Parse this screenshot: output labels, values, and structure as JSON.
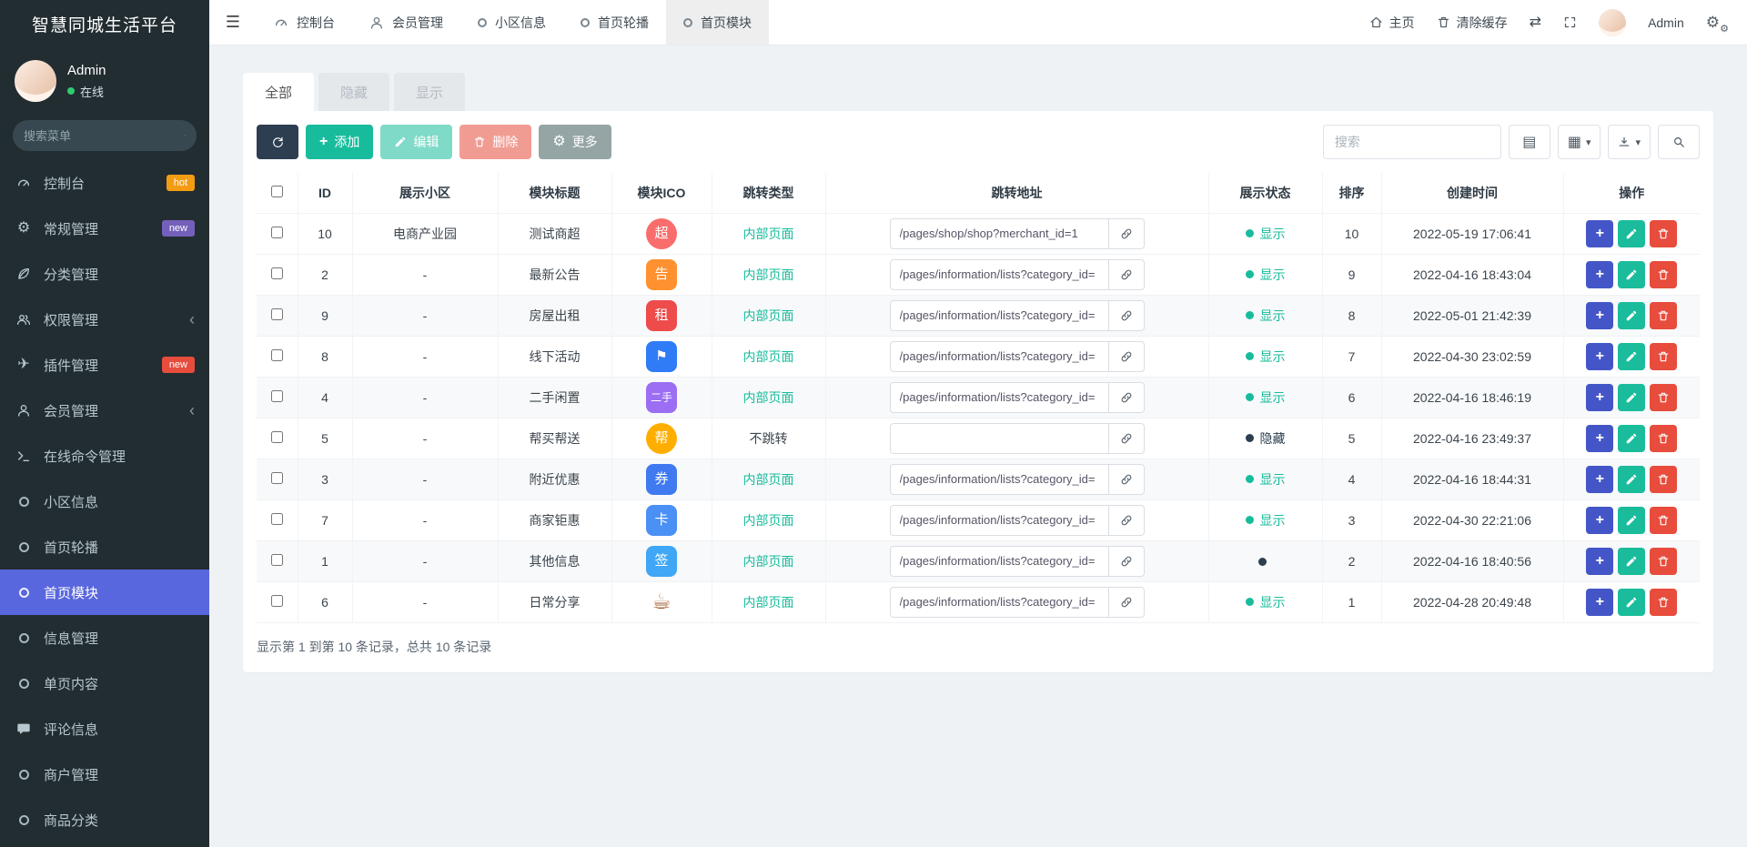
{
  "app": {
    "title": "智慧同城生活平台"
  },
  "colors": {
    "sidebar_bg": "#222d32",
    "accent_active": "#5867dd",
    "success": "#18bc9c",
    "danger": "#e74c3c",
    "warning": "#f39c12",
    "dark": "#2c3e50",
    "secondary": "#95a5a6"
  },
  "sidebar": {
    "user": {
      "name": "Admin",
      "status": "在线"
    },
    "search_placeholder": "搜索菜单",
    "items": [
      {
        "label": "控制台",
        "icon": "dashboard-icon",
        "badge": "hot",
        "badge_color": "#f39c12"
      },
      {
        "label": "常规管理",
        "icon": "gears-icon",
        "badge": "new",
        "badge_color": "#7460ba"
      },
      {
        "label": "分类管理",
        "icon": "leaf-icon"
      },
      {
        "label": "权限管理",
        "icon": "users-icon",
        "chevron": "‹"
      },
      {
        "label": "插件管理",
        "icon": "rocket-icon",
        "badge": "new",
        "badge_color": "#e74c3c"
      },
      {
        "label": "会员管理",
        "icon": "user-icon",
        "chevron": "‹"
      },
      {
        "label": "在线命令管理",
        "icon": "terminal-icon"
      },
      {
        "label": "小区信息",
        "icon": "circle-icon"
      },
      {
        "label": "首页轮播",
        "icon": "circle-icon"
      },
      {
        "label": "首页模块",
        "icon": "circle-icon",
        "active": true
      },
      {
        "label": "信息管理",
        "icon": "circle-icon"
      },
      {
        "label": "单页内容",
        "icon": "circle-icon"
      },
      {
        "label": "评论信息",
        "icon": "comment-icon"
      },
      {
        "label": "商户管理",
        "icon": "circle-icon"
      },
      {
        "label": "商品分类",
        "icon": "circle-icon"
      }
    ]
  },
  "topbar": {
    "tabs": [
      {
        "label": "控制台",
        "icon": "dashboard-icon"
      },
      {
        "label": "会员管理",
        "icon": "user-icon"
      },
      {
        "label": "小区信息",
        "icon": "circle-icon"
      },
      {
        "label": "首页轮播",
        "icon": "circle-icon"
      },
      {
        "label": "首页模块",
        "icon": "circle-icon",
        "active": true
      }
    ],
    "home": "主页",
    "clear_cache": "清除缓存",
    "username": "Admin"
  },
  "filter_tabs": [
    {
      "label": "全部",
      "active": true
    },
    {
      "label": "隐藏"
    },
    {
      "label": "显示"
    }
  ],
  "toolbar": {
    "add": "添加",
    "edit": "编辑",
    "delete": "删除",
    "more": "更多",
    "search_placeholder": "搜索"
  },
  "table": {
    "headers": [
      "ID",
      "展示小区",
      "模块标题",
      "模块ICO",
      "跳转类型",
      "跳转地址",
      "展示状态",
      "排序",
      "创建时间",
      "操作"
    ],
    "rows": [
      {
        "id": "10",
        "community": "电商产业园",
        "title": "测试商超",
        "ico": {
          "glyph": "超",
          "bg": "#f96d6d"
        },
        "jump_type": "内部页面",
        "url": "/pages/shop/shop?merchant_id=1",
        "status": "显示",
        "sort": "10",
        "created": "2022-05-19 17:06:41"
      },
      {
        "id": "2",
        "community": "-",
        "title": "最新公告",
        "ico": {
          "glyph": "告",
          "bg": "#ff9130"
        },
        "jump_type": "内部页面",
        "url": "/pages/information/lists?category_id=",
        "status": "显示",
        "sort": "9",
        "created": "2022-04-16 18:43:04"
      },
      {
        "id": "9",
        "community": "-",
        "title": "房屋出租",
        "ico": {
          "glyph": "租",
          "bg": "#ee4b4b"
        },
        "jump_type": "内部页面",
        "url": "/pages/information/lists?category_id=",
        "status": "显示",
        "sort": "8",
        "created": "2022-05-01 21:42:39"
      },
      {
        "id": "8",
        "community": "-",
        "title": "线下活动",
        "ico": {
          "glyph": "⚑",
          "bg": "#2f7cf6"
        },
        "jump_type": "内部页面",
        "url": "/pages/information/lists?category_id=",
        "status": "显示",
        "sort": "7",
        "created": "2022-04-30 23:02:59"
      },
      {
        "id": "4",
        "community": "-",
        "title": "二手闲置",
        "ico": {
          "glyph": "二手",
          "bg": "#9b6ef3"
        },
        "jump_type": "内部页面",
        "url": "/pages/information/lists?category_id=",
        "status": "显示",
        "sort": "6",
        "created": "2022-04-16 18:46:19"
      },
      {
        "id": "5",
        "community": "-",
        "title": "帮买帮送",
        "ico": {
          "glyph": "帮",
          "bg": "#ffae00"
        },
        "jump_type": "不跳转",
        "url": "",
        "status": "隐藏",
        "sort": "5",
        "created": "2022-04-16 23:49:37"
      },
      {
        "id": "3",
        "community": "-",
        "title": "附近优惠",
        "ico": {
          "glyph": "券",
          "bg": "#3f7af0"
        },
        "jump_type": "内部页面",
        "url": "/pages/information/lists?category_id=",
        "status": "显示",
        "sort": "4",
        "created": "2022-04-16 18:44:31"
      },
      {
        "id": "7",
        "community": "-",
        "title": "商家钜惠",
        "ico": {
          "glyph": "卡",
          "bg": "#4a90f5"
        },
        "jump_type": "内部页面",
        "url": "/pages/information/lists?category_id=",
        "status": "显示",
        "sort": "3",
        "created": "2022-04-30 22:21:06"
      },
      {
        "id": "1",
        "community": "-",
        "title": "其他信息",
        "ico": {
          "glyph": "签",
          "bg": "#3fa7f5"
        },
        "jump_type": "内部页面",
        "url": "/pages/information/lists?category_id=",
        "status": "",
        "sort": "2",
        "created": "2022-04-16 18:40:56"
      },
      {
        "id": "6",
        "community": "-",
        "title": "日常分享",
        "ico": {
          "glyph": "☕",
          "bg": "transparent",
          "color": "#a05a2c"
        },
        "jump_type": "内部页面",
        "url": "/pages/information/lists?category_id=",
        "status": "显示",
        "sort": "1",
        "created": "2022-04-28 20:49:48"
      }
    ],
    "footer": "显示第 1 到第 10 条记录，总共 10 条记录"
  }
}
